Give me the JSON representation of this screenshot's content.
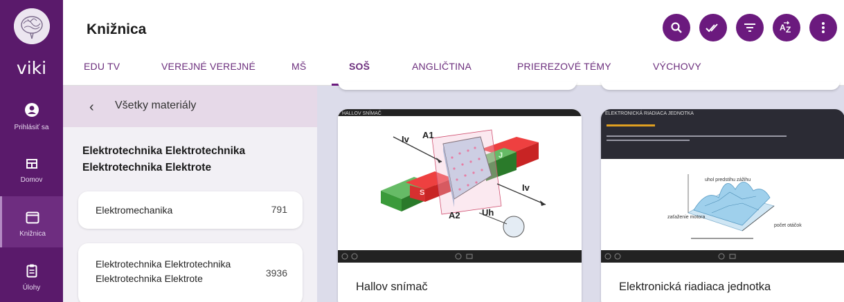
{
  "rail": {
    "brand": "viki",
    "items": [
      {
        "label": "Prihlásiť sa",
        "icon": "account-circle-icon"
      },
      {
        "label": "Domov",
        "icon": "home-grid-icon"
      },
      {
        "label": "Knižnica",
        "icon": "library-window-icon"
      },
      {
        "label": "Úlohy",
        "icon": "clipboard-icon"
      }
    ]
  },
  "header": {
    "title": "Knižnica",
    "actions": [
      "search-icon",
      "done-all-icon",
      "filter-icon",
      "sort-az-icon",
      "more-vert-icon"
    ],
    "tabs": [
      "EDU TV",
      "VEREJNÉ VEREJNÉ",
      "MŠ",
      "SOŠ",
      "ANGLIČTINA",
      "PRIEREZOVÉ TÉMY",
      "VÝCHOVY"
    ],
    "active_tab": "SOŠ"
  },
  "sidebar": {
    "back_label": "Všetky materiály",
    "category": "Elektrotechnika Elektrotechnika Elektrotechnika Elektrote",
    "items": [
      {
        "name": "Elektromechanika",
        "count": "791"
      },
      {
        "name": "Elektrotechnika Elektrotechnika Elektrotechnika Elektrote",
        "count": "3936"
      }
    ]
  },
  "videos": [
    {
      "title": "Hallov snímač",
      "thumb_caption": "HALLOV SNÍMAČ",
      "thumb_labels": [
        "Iv",
        "A1",
        "Iv",
        "A2",
        "Uh",
        "S",
        "J"
      ]
    },
    {
      "title": "Elektronická riadiaca jednotka",
      "thumb_caption": "ELEKTRONICKÁ RIADIACA JEDNOTKA",
      "thumb_labels": [
        "uhol predstihu zážihu",
        "zaťaženie motora",
        "počet otáčok"
      ]
    }
  ],
  "colors": {
    "rail": "#5a1a6b",
    "accent": "#6b1a7e",
    "tab_text": "#6b2d7c",
    "content_bg": "#dcdcea",
    "sidebar_head": "#e6d9e8"
  }
}
